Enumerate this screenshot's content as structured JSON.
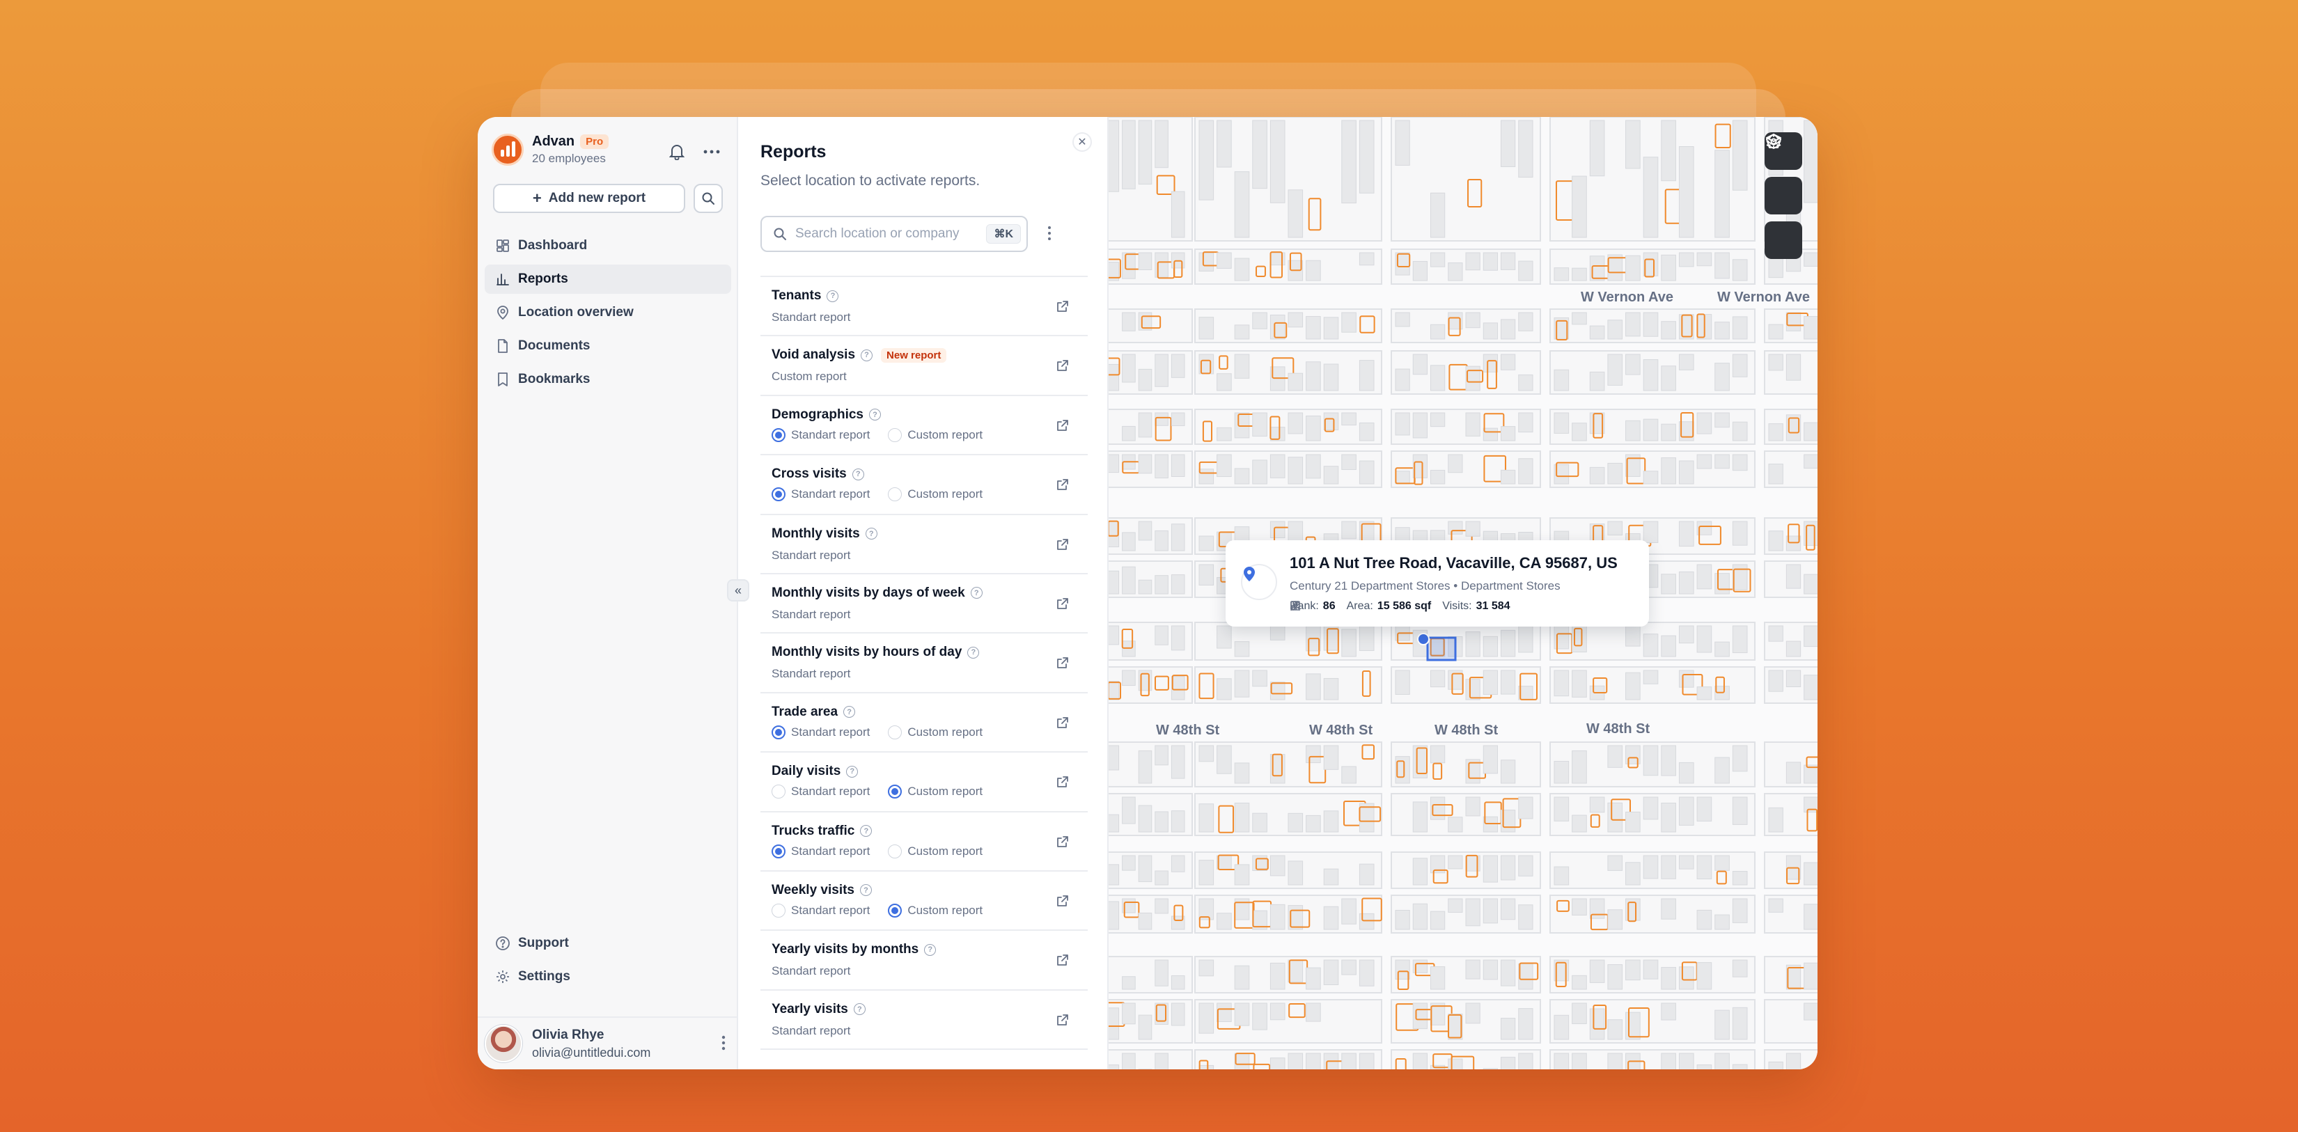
{
  "brand": {
    "name": "Advan",
    "badge": "Pro",
    "subtitle": "20 employees",
    "color": "#e8601f"
  },
  "sidebar": {
    "add_report_label": "Add new report",
    "nav": [
      {
        "label": "Dashboard",
        "icon": "dashboard-icon",
        "active": false
      },
      {
        "label": "Reports",
        "icon": "bar-chart-icon",
        "active": true
      },
      {
        "label": "Location overview",
        "icon": "location-pin-icon",
        "active": false
      },
      {
        "label": "Documents",
        "icon": "document-icon",
        "active": false
      },
      {
        "label": "Bookmarks",
        "icon": "bookmark-icon",
        "active": false
      }
    ],
    "bottom_nav": [
      {
        "label": "Support",
        "icon": "help-circle-icon"
      },
      {
        "label": "Settings",
        "icon": "gear-icon"
      }
    ],
    "user": {
      "name": "Olivia Rhye",
      "email": "olivia@untitledui.com"
    }
  },
  "reports": {
    "title": "Reports",
    "subtitle": "Select location to activate reports.",
    "search_placeholder": "Search location or company",
    "shortcut": "⌘K",
    "labels": {
      "standard": "Standart report",
      "custom": "Custom report"
    },
    "items": [
      {
        "title": "Tenants",
        "kind": "text",
        "type_label": "Standart report"
      },
      {
        "title": "Void analysis",
        "kind": "text",
        "type_label": "Custom report",
        "badge": "New report"
      },
      {
        "title": "Demographics",
        "kind": "radio",
        "selected": "standard"
      },
      {
        "title": "Cross visits",
        "kind": "radio",
        "selected": "standard"
      },
      {
        "title": "Monthly visits",
        "kind": "text",
        "type_label": "Standart report"
      },
      {
        "title": "Monthly visits by days of week",
        "kind": "text",
        "type_label": "Standart report"
      },
      {
        "title": "Monthly visits by hours of day",
        "kind": "text",
        "type_label": "Standart report"
      },
      {
        "title": "Trade area",
        "kind": "radio",
        "selected": "standard"
      },
      {
        "title": "Daily visits",
        "kind": "radio",
        "selected": "custom"
      },
      {
        "title": "Trucks traffic",
        "kind": "radio",
        "selected": "standard"
      },
      {
        "title": "Weekly visits",
        "kind": "radio",
        "selected": "custom"
      },
      {
        "title": "Yearly visits by months",
        "kind": "text",
        "type_label": "Standart report"
      },
      {
        "title": "Yearly visits",
        "kind": "text",
        "type_label": "Standart report"
      }
    ]
  },
  "map": {
    "streets": {
      "vernon_1": "W Vernon Ave",
      "vernon_2": "W Vernon Ave",
      "w48_1": "W 48th St",
      "w48_2": "W 48th St",
      "w48_3": "W 48th St",
      "w48_4": "W 48th St"
    },
    "tools": [
      "layers-icon",
      "pentagon-icon",
      "gear-icon"
    ],
    "popup": {
      "address": "101 A Nut Tree Road, Vacaville, CA 95687, US",
      "category": "Century 21 Department Stores • Department Stores",
      "rank_label": "Rank:",
      "rank": "86",
      "area_label": "Area:",
      "area": "15 586 sqf",
      "visits_label": "Visits:",
      "visits": "31 584"
    },
    "colors": {
      "parcel": "#f08a2c",
      "selected": "#3e6fe0",
      "building": "#e7e8ea"
    }
  }
}
